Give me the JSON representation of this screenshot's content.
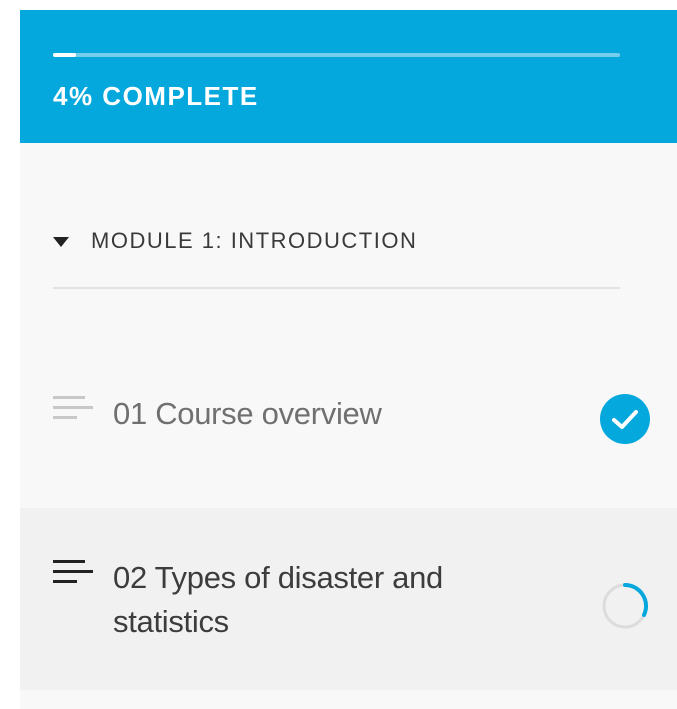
{
  "progress": {
    "percent": 4,
    "label": "4% COMPLETE"
  },
  "module": {
    "title": "MODULE 1: INTRODUCTION",
    "expanded": true
  },
  "lessons": [
    {
      "title": "01 Course overview",
      "status": "complete",
      "icon": "text-lines-icon"
    },
    {
      "title": "02 Types of disaster and statistics",
      "status": "in-progress",
      "icon": "text-lines-icon"
    }
  ],
  "colors": {
    "accent": "#05a8dd",
    "panel_bg": "#f8f8f8",
    "active_row_bg": "#f1f1f1"
  }
}
